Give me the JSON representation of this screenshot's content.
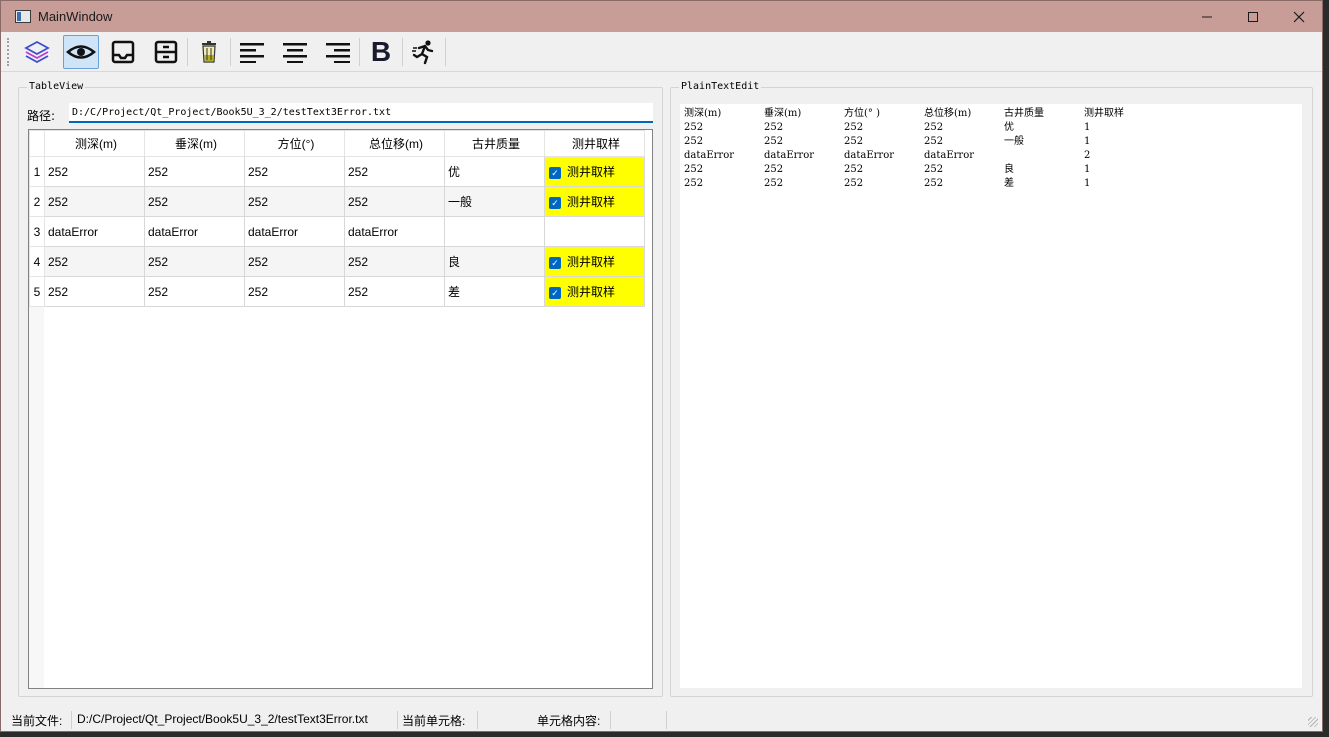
{
  "window": {
    "title": "MainWindow",
    "minimize_glyph": "—",
    "maximize_glyph": "☐",
    "close_glyph": "✕"
  },
  "toolbar": {
    "buttons": [
      {
        "name": "layers-icon"
      },
      {
        "name": "eye-icon",
        "active": true
      },
      {
        "name": "inbox-icon"
      },
      {
        "name": "archive-icon"
      },
      {
        "name": "trash-icon"
      },
      {
        "name": "align-left-icon"
      },
      {
        "name": "align-center-icon"
      },
      {
        "name": "align-right-icon"
      },
      {
        "name": "bold-icon",
        "glyph": "B"
      },
      {
        "name": "run-icon"
      }
    ]
  },
  "table_view": {
    "group_title": "TableView",
    "path_label": "路径:",
    "path_value": "D:/C/Project/Qt_Project/Book5U_3_2/testText3Error.txt",
    "headers": [
      "测深(m)",
      "垂深(m)",
      "方位(°)",
      "总位移(m)",
      "古井质量",
      "测井取样"
    ],
    "rows": [
      {
        "num": "1",
        "cells": [
          "252",
          "252",
          "252",
          "252",
          "优"
        ],
        "sample": "测井取样",
        "checked": true
      },
      {
        "num": "2",
        "cells": [
          "252",
          "252",
          "252",
          "252",
          "一般"
        ],
        "sample": "测井取样",
        "checked": true
      },
      {
        "num": "3",
        "cells": [
          "dataError",
          "dataError",
          "dataError",
          "dataError",
          ""
        ],
        "sample": "",
        "checked": false
      },
      {
        "num": "4",
        "cells": [
          "252",
          "252",
          "252",
          "252",
          "良"
        ],
        "sample": "测井取样",
        "checked": true
      },
      {
        "num": "5",
        "cells": [
          "252",
          "252",
          "252",
          "252",
          "差"
        ],
        "sample": "测井取样",
        "checked": true
      }
    ],
    "highlight_color": "#ffff00",
    "checkbox_color": "#0067c0"
  },
  "plain_text": {
    "group_title": "PlainTextEdit",
    "lines": [
      [
        "测深(m)",
        "垂深(m)",
        "方位(° )",
        "总位移(m)",
        "古井质量",
        "测井取样"
      ],
      [
        "252",
        "252",
        "252",
        "252",
        "优",
        "1"
      ],
      [
        "252",
        "252",
        "252",
        "252",
        "一般",
        "1"
      ],
      [
        "dataError",
        "dataError",
        "dataError",
        "dataError",
        "",
        "2"
      ],
      [
        "252",
        "252",
        "252",
        "252",
        "良",
        "1"
      ],
      [
        "252",
        "252",
        "252",
        "252",
        "差",
        "1"
      ]
    ]
  },
  "status_bar": {
    "file_label": "当前文件:",
    "file_value": "D:/C/Project/Qt_Project/Book5U_3_2/testText3Error.txt",
    "cell_label": "当前单元格:",
    "cell_value": "",
    "content_label": "单元格内容:",
    "content_value": ""
  }
}
